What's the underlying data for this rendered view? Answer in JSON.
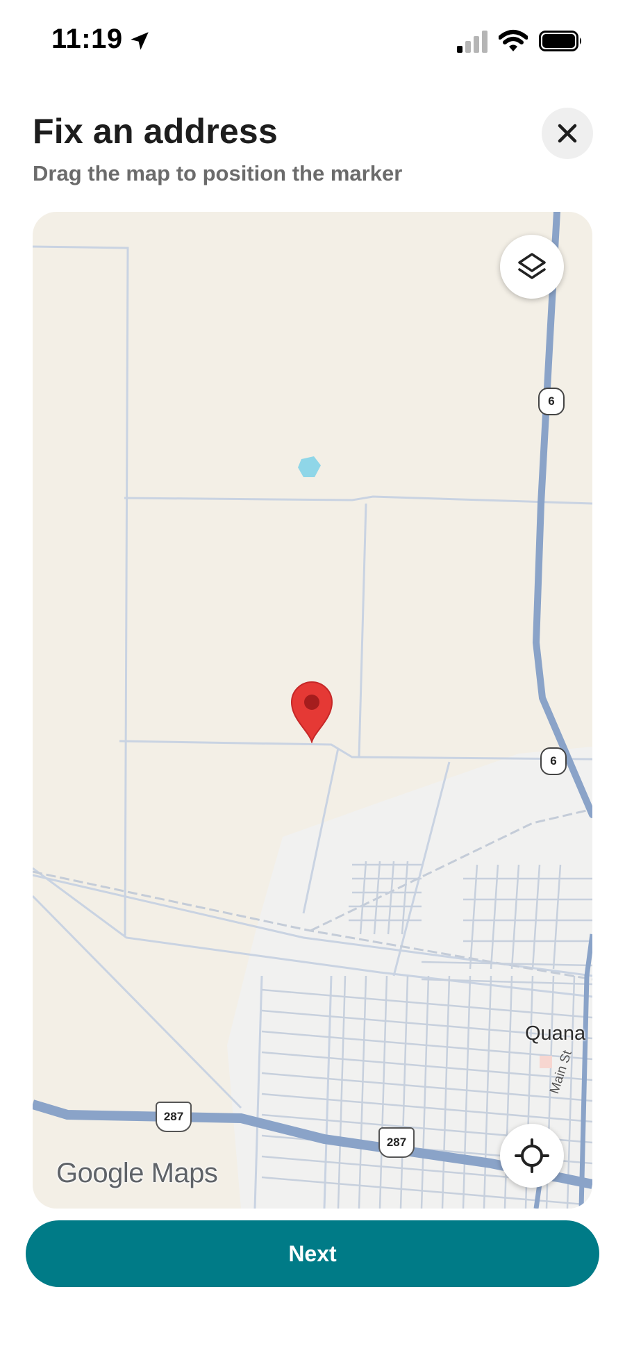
{
  "status_bar": {
    "time": "11:19"
  },
  "header": {
    "title": "Fix an address",
    "subtitle": "Drag the map to position the marker"
  },
  "map": {
    "place_label": "Quana",
    "street_label": "Main St",
    "shields": {
      "state_route": "6",
      "us_route": "287"
    },
    "attribution": "Google Maps"
  },
  "actions": {
    "next_label": "Next"
  },
  "colors": {
    "accent": "#007b87",
    "marker": "#e53935",
    "map_land": "#f3efe6",
    "highway": "#8aa3c8"
  }
}
